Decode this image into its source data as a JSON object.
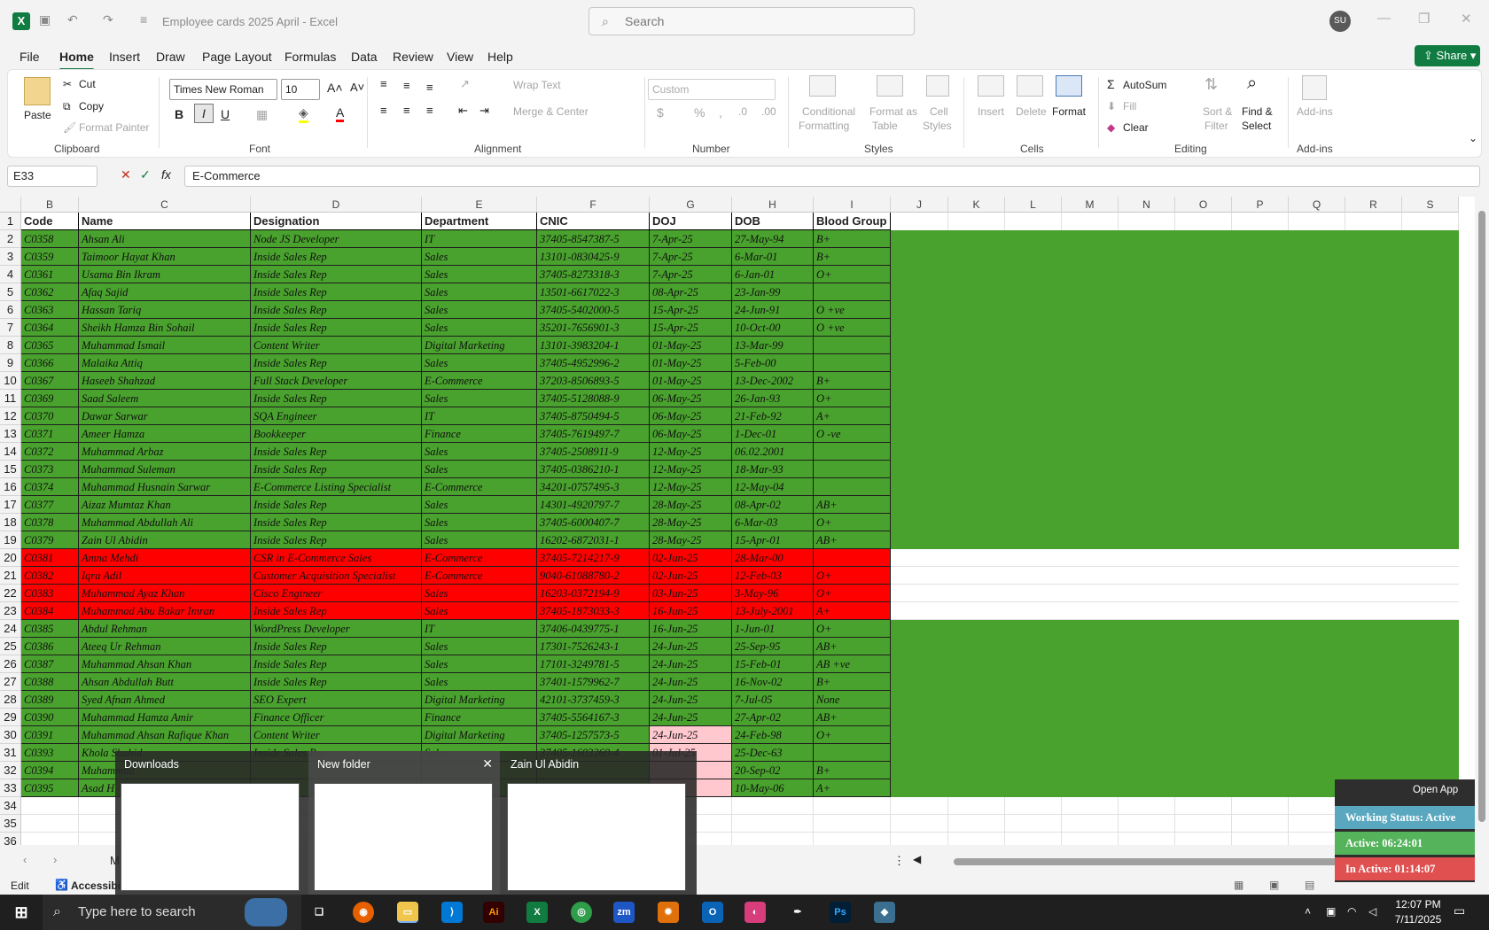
{
  "app": {
    "title": "Employee cards 2025 April  -  Excel",
    "search_placeholder": "Search",
    "user_initials": "SU",
    "share_label": "Share"
  },
  "menu": [
    "File",
    "Home",
    "Insert",
    "Draw",
    "Page Layout",
    "Formulas",
    "Data",
    "Review",
    "View",
    "Help"
  ],
  "ribbon": {
    "clipboard": {
      "paste": "Paste",
      "cut": "Cut",
      "copy": "Copy",
      "format_painter": "Format Painter",
      "group": "Clipboard"
    },
    "font": {
      "name": "Times New Roman",
      "size": "10",
      "group": "Font"
    },
    "alignment": {
      "wrap_text": "Wrap Text",
      "merge_center": "Merge & Center",
      "group": "Alignment"
    },
    "number": {
      "format": "Custom",
      "group": "Number"
    },
    "styles": {
      "conditional": "Conditional",
      "formatting": "Formatting",
      "format_as": "Format as",
      "table": "Table",
      "cell": "Cell",
      "styles_l": "Styles",
      "group": "Styles"
    },
    "cells": {
      "insert": "Insert",
      "delete": "Delete",
      "format": "Format",
      "group": "Cells"
    },
    "editing": {
      "autosum": "AutoSum",
      "fill": "Fill",
      "clear": "Clear",
      "sort": "Sort &",
      "filter": "Filter",
      "find": "Find &",
      "select": "Select",
      "group": "Editing"
    },
    "addins": {
      "label": "Add-ins",
      "group": "Add-ins"
    }
  },
  "formula_bar": {
    "cell_ref": "E33",
    "value": "E-Commerce"
  },
  "columns": [
    "B",
    "C",
    "D",
    "E",
    "F",
    "G",
    "H",
    "I",
    "J",
    "K",
    "L",
    "M",
    "N",
    "O",
    "P",
    "Q",
    "R",
    "S"
  ],
  "table_headers": [
    "Code",
    "Name",
    "Designation",
    "Department",
    "CNIC",
    "DOJ",
    "DOB",
    "Blood Group"
  ],
  "rows": [
    {
      "n": "2",
      "c": [
        "C0358",
        "Ahsan Ali",
        "Node JS Developer",
        "IT",
        "37405-8547387-5",
        "7-Apr-25",
        "27-May-94",
        "B+"
      ],
      "fill": "#49a22d"
    },
    {
      "n": "3",
      "c": [
        "C0359",
        "Taimoor Hayat Khan",
        "Inside Sales Rep",
        "Sales",
        "13101-0830425-9",
        "7-Apr-25",
        "6-Mar-01",
        "B+"
      ],
      "fill": "#49a22d"
    },
    {
      "n": "4",
      "c": [
        "C0361",
        "Usama Bin Ikram",
        "Inside Sales Rep",
        "Sales",
        "37405-8273318-3",
        "7-Apr-25",
        "6-Jan-01",
        "O+"
      ],
      "fill": "#49a22d"
    },
    {
      "n": "5",
      "c": [
        "C0362",
        "Afaq Sajid",
        "Inside Sales Rep",
        "Sales",
        "13501-6617022-3",
        "08-Apr-25",
        "23-Jan-99",
        ""
      ],
      "fill": "#49a22d"
    },
    {
      "n": "6",
      "c": [
        "C0363",
        "Hassan Tariq",
        "Inside Sales Rep",
        "Sales",
        "37405-5402000-5",
        "15-Apr-25",
        "24-Jun-91",
        "O +ve"
      ],
      "fill": "#49a22d"
    },
    {
      "n": "7",
      "c": [
        "C0364",
        "Sheikh Hamza Bin Sohail",
        "Inside Sales Rep",
        "Sales",
        "35201-7656901-3",
        "15-Apr-25",
        "10-Oct-00",
        "O +ve"
      ],
      "fill": "#49a22d"
    },
    {
      "n": "8",
      "c": [
        "C0365",
        "Muhammad Ismail",
        "Content Writer",
        "Digital Marketing",
        "13101-3983204-1",
        "01-May-25",
        "13-Mar-99",
        ""
      ],
      "fill": "#49a22d"
    },
    {
      "n": "9",
      "c": [
        "C0366",
        "Malaika Attiq",
        "Inside Sales Rep",
        "Sales",
        "37405-4952996-2",
        "01-May-25",
        "5-Feb-00",
        ""
      ],
      "fill": "#49a22d"
    },
    {
      "n": "10",
      "c": [
        "C0367",
        "Haseeb Shahzad",
        "Full Stack Developer",
        "E-Commerce",
        "37203-8506893-5",
        "01-May-25",
        "13-Dec-2002",
        "B+"
      ],
      "fill": "#49a22d"
    },
    {
      "n": "11",
      "c": [
        "C0369",
        "Saad Saleem",
        "Inside Sales Rep",
        "Sales",
        "37405-5128088-9",
        "06-May-25",
        "26-Jan-93",
        "O+"
      ],
      "fill": "#49a22d"
    },
    {
      "n": "12",
      "c": [
        "C0370",
        "Dawar Sarwar",
        "SQA Engineer",
        "IT",
        "37405-8750494-5",
        "06-May-25",
        "21-Feb-92",
        "A+"
      ],
      "fill": "#49a22d"
    },
    {
      "n": "13",
      "c": [
        "C0371",
        "Ameer Hamza",
        "Bookkeeper",
        "Finance",
        "37405-7619497-7",
        "06-May-25",
        "1-Dec-01",
        "O -ve"
      ],
      "fill": "#49a22d"
    },
    {
      "n": "14",
      "c": [
        "C0372",
        "Muhammad Arbaz",
        "Inside Sales Rep",
        "Sales",
        "37405-2508911-9",
        "12-May-25",
        "06.02.2001",
        ""
      ],
      "fill": "#49a22d"
    },
    {
      "n": "15",
      "c": [
        "C0373",
        "Muhammad Suleman",
        "Inside Sales Rep",
        "Sales",
        "37405-0386210-1",
        "12-May-25",
        "18-Mar-93",
        ""
      ],
      "fill": "#49a22d"
    },
    {
      "n": "16",
      "c": [
        "C0374",
        "Muhammad Husnain Sarwar",
        "E-Commerce Listing Specialist",
        "E-Commerce",
        "34201-0757495-3",
        "12-May-25",
        "12-May-04",
        ""
      ],
      "fill": "#49a22d"
    },
    {
      "n": "17",
      "c": [
        "C0377",
        "Aizaz Mumtaz Khan",
        "Inside Sales Rep",
        "Sales",
        "14301-4920797-7",
        "28-May-25",
        "08-Apr-02",
        "AB+"
      ],
      "fill": "#49a22d"
    },
    {
      "n": "18",
      "c": [
        "C0378",
        "Muhammad Abdullah Ali",
        "Inside Sales Rep",
        "Sales",
        "37405-6000407-7",
        "28-May-25",
        "6-Mar-03",
        "O+"
      ],
      "fill": "#49a22d"
    },
    {
      "n": "19",
      "c": [
        "C0379",
        "Zain Ul Abidin",
        "Inside Sales Rep",
        "Sales",
        "16202-6872031-1",
        "28-May-25",
        "15-Apr-01",
        "AB+"
      ],
      "fill": "#49a22d"
    },
    {
      "n": "20",
      "c": [
        "C0381",
        "Amna Mehdi",
        "CSR in E-Commerce Sales",
        "E-Commerce",
        "37405-7214217-9",
        "02-Jun-25",
        "28-Mar-00",
        ""
      ],
      "fill": "#ff0000"
    },
    {
      "n": "21",
      "c": [
        "C0382",
        "Iqra Adil",
        "Customer Acquisition Specialist",
        "E-Commerce",
        "9040-61088780-2",
        "02-Jun-25",
        "12-Feb-03",
        "O+"
      ],
      "fill": "#ff0000"
    },
    {
      "n": "22",
      "c": [
        "C0383",
        "Muhammad Ayaz Khan",
        "Cisco Engineer",
        "Sales",
        "16203-0372194-9",
        "03-Jun-25",
        "3-May-96",
        "O+"
      ],
      "fill": "#ff0000"
    },
    {
      "n": "23",
      "c": [
        "C0384",
        "Muhammad Abu Bakar Imran",
        "Inside Sales Rep",
        "Sales",
        "37405-1873033-3",
        "16-Jun-25",
        "13-July-2001",
        "A+"
      ],
      "fill": "#ff0000"
    },
    {
      "n": "24",
      "c": [
        "C0385",
        "Abdul Rehman",
        "WordPress Developer",
        "IT",
        "37406-0439775-1",
        "16-Jun-25",
        "1-Jun-01",
        "O+"
      ],
      "fill": "#49a22d"
    },
    {
      "n": "25",
      "c": [
        "C0386",
        "Ateeq Ur Rehman",
        "Inside Sales Rep",
        "Sales",
        "17301-7526243-1",
        "24-Jun-25",
        "25-Sep-95",
        "AB+"
      ],
      "fill": "#49a22d"
    },
    {
      "n": "26",
      "c": [
        "C0387",
        "Muhammad Ahsan Khan",
        "Inside Sales Rep",
        "Sales",
        "17101-3249781-5",
        "24-Jun-25",
        "15-Feb-01",
        "AB +ve"
      ],
      "fill": "#49a22d"
    },
    {
      "n": "27",
      "c": [
        "C0388",
        "Ahsan Abdullah Butt",
        "Inside Sales Rep",
        "Sales",
        "37401-1579962-7",
        "24-Jun-25",
        "16-Nov-02",
        "B+"
      ],
      "fill": "#49a22d"
    },
    {
      "n": "28",
      "c": [
        "C0389",
        "Syed Afnan Ahmed",
        "SEO Expert",
        "Digital Marketing",
        "42101-3737459-3",
        "24-Jun-25",
        "7-Jul-05",
        "None"
      ],
      "fill": "#49a22d"
    },
    {
      "n": "29",
      "c": [
        "C0390",
        "Muhammad Hamza Amir",
        "Finance Officer",
        "Finance",
        "37405-5564167-3",
        "24-Jun-25",
        "27-Apr-02",
        "AB+"
      ],
      "fill": "#49a22d"
    },
    {
      "n": "30",
      "c": [
        "C0391",
        "Muhammad Ahsan Rafique Khan",
        "Content Writer",
        "Digital Marketing",
        "37405-1257573-5",
        "24-Jun-25",
        "24-Feb-98",
        "O+"
      ],
      "fill": "#49a22d"
    },
    {
      "n": "31",
      "c": [
        "C0393",
        "Khola Shahid",
        "Inside Sales Rep",
        "Sales",
        "37405-1603260-4",
        "01-Jul-25",
        "25-Dec-63",
        ""
      ],
      "fill": "#49a22d"
    },
    {
      "n": "32",
      "c": [
        "C0394",
        "Muhammad",
        "",
        "",
        "",
        "",
        "20-Sep-02",
        "B+"
      ],
      "fill": "#49a22d"
    },
    {
      "n": "33",
      "c": [
        "C0395",
        "Asad H",
        "",
        "",
        "",
        "",
        "10-May-06",
        "A+"
      ],
      "fill": "#49a22d"
    }
  ],
  "empty_rows": [
    "34",
    "35",
    "36"
  ],
  "sheet_tab_partial": "M",
  "status": {
    "mode": "Edit",
    "accessibility": "Accessibili"
  },
  "taskbar": {
    "search_placeholder": "Type here to search",
    "time": "12:07 PM",
    "date": "7/11/2025"
  },
  "thumbnails": [
    {
      "title": "Downloads"
    },
    {
      "title": "New folder"
    },
    {
      "title": "Zain Ul Abidin"
    }
  ],
  "widget": {
    "open_app": "Open App",
    "status": "Working Status: Active",
    "active": "Active: 06:24:01",
    "inactive": "In Active: 01:14:07"
  },
  "colors": {
    "green": "#49a22d",
    "red": "#ff0000",
    "excel": "#107c41",
    "pink": "#ffc7ce"
  }
}
